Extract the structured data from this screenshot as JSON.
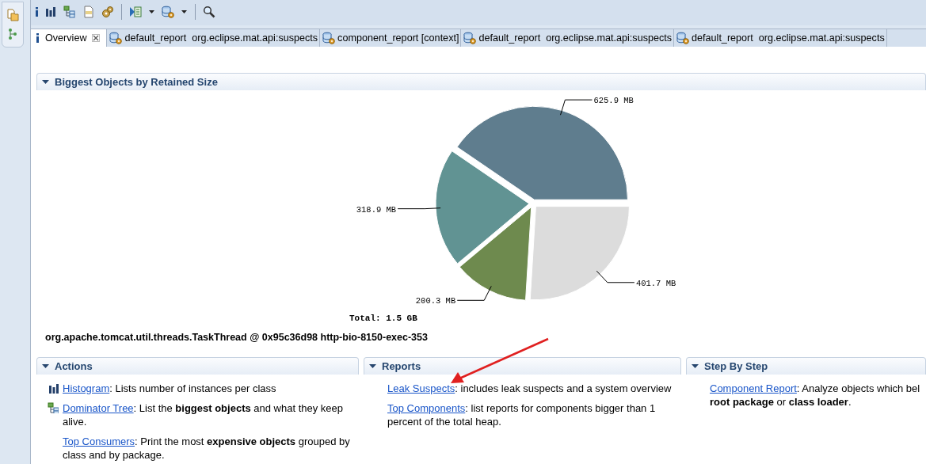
{
  "tabs": [
    {
      "kind": "info",
      "label": "Overview",
      "selected": true
    },
    {
      "kind": "report",
      "label": "default_report  org.eclipse.mat.api:suspects",
      "selected": false
    },
    {
      "kind": "report",
      "label": "component_report [context]",
      "selected": false
    },
    {
      "kind": "report",
      "label": "default_report  org.eclipse.mat.api:suspects",
      "selected": false
    },
    {
      "kind": "report",
      "label": "default_report  org.eclipse.mat.api:suspects",
      "selected": false
    }
  ],
  "chart_section": {
    "title": "Biggest Objects by Retained Size",
    "expanded": true,
    "chart_data": {
      "type": "pie",
      "values": [
        625.9,
        318.9,
        200.3,
        401.7
      ],
      "value_labels": [
        "625.9 MB",
        "318.9 MB",
        "200.3 MB",
        "401.7 MB"
      ],
      "annotations": [
        "Total: 1.5 GB"
      ]
    }
  },
  "selected_object": "org.apache.tomcat.util.threads.TaskThread @ 0x95c36d98 http-bio-8150-exec-353",
  "panels": [
    {
      "title": "Actions",
      "expanded": true,
      "items": [
        {
          "kind": "histogram",
          "link": "Histogram",
          "text": ": Lists number of instances per class"
        },
        {
          "kind": "tree",
          "link": "Dominator Tree",
          "text": ": List the **biggest objects** and what they keep alive."
        },
        {
          "kind": "plain",
          "link": "Top Consumers",
          "text": ": Print the most **expensive objects** grouped by class and by package."
        }
      ]
    },
    {
      "title": "Reports",
      "expanded": true,
      "items": [
        {
          "kind": "plain",
          "link": "Leak Suspects",
          "text": ": includes leak suspects and a system overview"
        },
        {
          "kind": "plain",
          "link": "Top Components",
          "text": ": list reports for components bigger than 1 percent of the total heap."
        }
      ]
    },
    {
      "title": "Step By Step",
      "expanded": true,
      "items": [
        {
          "kind": "plain",
          "link": "Component Report",
          "text": ": Analyze objects which bel\n**root package** or **class loader**."
        }
      ]
    }
  ]
}
